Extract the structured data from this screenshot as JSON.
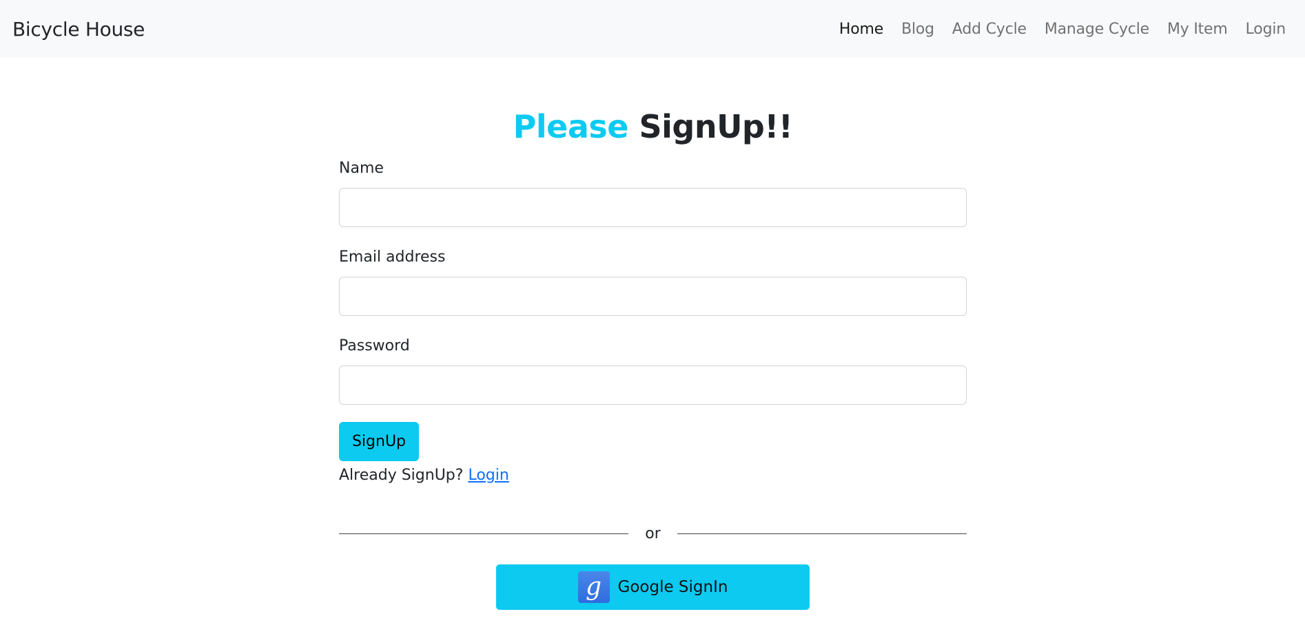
{
  "navbar": {
    "brand": "Bicycle House",
    "links": [
      {
        "label": "Home",
        "active": true
      },
      {
        "label": "Blog",
        "active": false
      },
      {
        "label": "Add Cycle",
        "active": false
      },
      {
        "label": "Manage Cycle",
        "active": false
      },
      {
        "label": "My Item",
        "active": false
      },
      {
        "label": "Login",
        "active": false
      }
    ]
  },
  "form": {
    "title_accent": "Please",
    "title_rest": "SignUp!!",
    "name_label": "Name",
    "name_value": "",
    "email_label": "Email address",
    "email_value": "",
    "password_label": "Password",
    "password_value": "",
    "submit_label": "SignUp",
    "already_text": "Already SignUp?",
    "login_link": "Login",
    "divider_text": "or",
    "google_button_label": "Google SignIn",
    "google_icon": "google-g-icon"
  },
  "colors": {
    "accent": "#0dcaf0",
    "link": "#0d6efd",
    "navbar_bg": "#f8f9fa"
  }
}
